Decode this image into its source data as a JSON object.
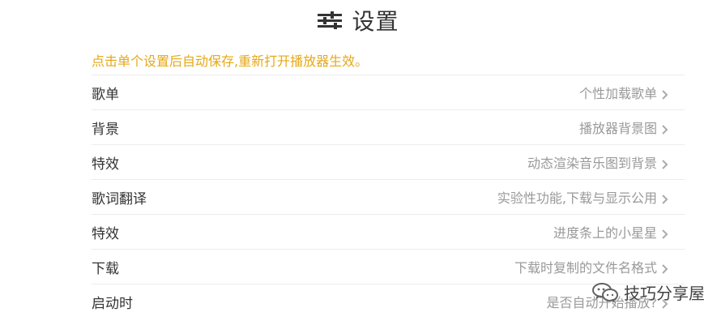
{
  "header": {
    "title": "设置",
    "icon": "sliders-icon"
  },
  "notice": "点击单个设置后自动保存,重新打开播放器生效。",
  "rows": [
    {
      "label": "歌单",
      "value": "个性加载歌单"
    },
    {
      "label": "背景",
      "value": "播放器背景图"
    },
    {
      "label": "特效",
      "value": "动态渲染音乐图到背景"
    },
    {
      "label": "歌词翻译",
      "value": "实验性功能,下载与显示公用"
    },
    {
      "label": "特效",
      "value": "进度条上的小星星"
    },
    {
      "label": "下载",
      "value": "下载时复制的文件名格式"
    },
    {
      "label": "启动时",
      "value": "是否自动开始播放?"
    }
  ],
  "watermark": {
    "text": "技巧分享屋",
    "icon": "chat-bubbles-icon"
  },
  "colors": {
    "notice": "#e6a817",
    "label": "#333333",
    "value": "#999999",
    "divider": "#ececec"
  }
}
